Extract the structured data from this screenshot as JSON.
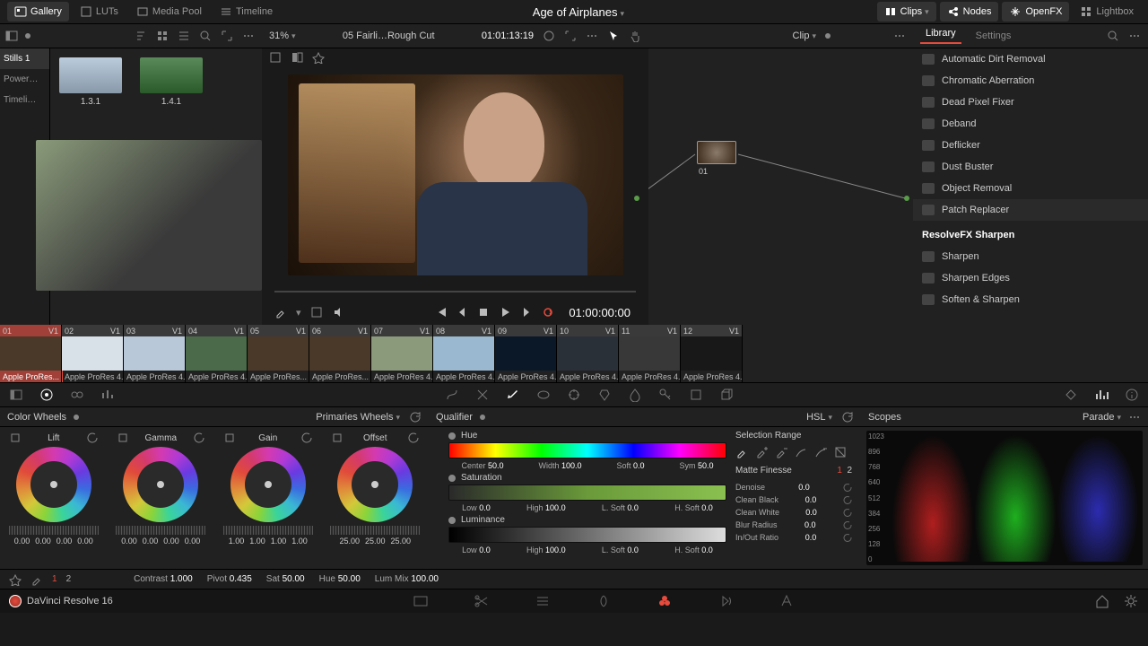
{
  "topbar": {
    "gallery": "Gallery",
    "luts": "LUTs",
    "mediapool": "Media Pool",
    "timeline": "Timeline",
    "title": "Age of Airplanes",
    "clips": "Clips",
    "nodes": "Nodes",
    "openfx": "OpenFX",
    "lightbox": "Lightbox"
  },
  "subbar": {
    "zoom": "31%",
    "project": "05 Fairli…Rough Cut",
    "timecode": "01:01:13:19",
    "nodes_mode": "Clip",
    "fx_tab1": "Library",
    "fx_tab2": "Settings"
  },
  "sidebar": [
    "Stills 1",
    "Power…",
    "Timeli…"
  ],
  "stills": [
    {
      "label": "1.3.1"
    },
    {
      "label": "1.4.1"
    }
  ],
  "viewer": {
    "tc": "01:00:00:00"
  },
  "node": {
    "label": "01"
  },
  "fx": {
    "items": [
      "Automatic Dirt Removal",
      "Chromatic Aberration",
      "Dead Pixel Fixer",
      "Deband",
      "Deflicker",
      "Dust Buster",
      "Object Removal",
      "Patch Replacer"
    ],
    "cat": "ResolveFX Sharpen",
    "items2": [
      "Sharpen",
      "Sharpen Edges",
      "Soften & Sharpen"
    ]
  },
  "clips": [
    {
      "n": "01",
      "v": "V1",
      "f": "Apple ProRes..."
    },
    {
      "n": "02",
      "v": "V1",
      "f": "Apple ProRes 4..."
    },
    {
      "n": "03",
      "v": "V1",
      "f": "Apple ProRes 4..."
    },
    {
      "n": "04",
      "v": "V1",
      "f": "Apple ProRes 4..."
    },
    {
      "n": "05",
      "v": "V1",
      "f": "Apple ProRes..."
    },
    {
      "n": "06",
      "v": "V1",
      "f": "Apple ProRes..."
    },
    {
      "n": "07",
      "v": "V1",
      "f": "Apple ProRes 4..."
    },
    {
      "n": "08",
      "v": "V1",
      "f": "Apple ProRes 4..."
    },
    {
      "n": "09",
      "v": "V1",
      "f": "Apple ProRes 4..."
    },
    {
      "n": "10",
      "v": "V1",
      "f": "Apple ProRes 4..."
    },
    {
      "n": "11",
      "v": "V1",
      "f": "Apple ProRes 4..."
    },
    {
      "n": "12",
      "v": "V1",
      "f": "Apple ProRes 4..."
    }
  ],
  "wheels": {
    "title": "Color Wheels",
    "mode": "Primaries Wheels",
    "cols": [
      {
        "name": "Lift",
        "nums": [
          "0.00",
          "0.00",
          "0.00",
          "0.00"
        ]
      },
      {
        "name": "Gamma",
        "nums": [
          "0.00",
          "0.00",
          "0.00",
          "0.00"
        ]
      },
      {
        "name": "Gain",
        "nums": [
          "1.00",
          "1.00",
          "1.00",
          "1.00"
        ]
      },
      {
        "name": "Offset",
        "nums": [
          "25.00",
          "25.00",
          "25.00"
        ]
      }
    ]
  },
  "adjust": {
    "page1": "1",
    "page2": "2",
    "contrast_l": "Contrast",
    "contrast": "1.000",
    "pivot_l": "Pivot",
    "pivot": "0.435",
    "sat_l": "Sat",
    "sat": "50.00",
    "hue_l": "Hue",
    "hue": "50.00",
    "lum_l": "Lum Mix",
    "lum": "100.00"
  },
  "qualifier": {
    "title": "Qualifier",
    "mode": "HSL",
    "hue": {
      "label": "Hue",
      "center_l": "Center",
      "center": "50.0",
      "width_l": "Width",
      "width": "100.0",
      "soft_l": "Soft",
      "soft": "0.0",
      "sym_l": "Sym",
      "sym": "50.0"
    },
    "sat": {
      "label": "Saturation",
      "low_l": "Low",
      "low": "0.0",
      "high_l": "High",
      "high": "100.0",
      "ls_l": "L. Soft",
      "ls": "0.0",
      "hs_l": "H. Soft",
      "hs": "0.0"
    },
    "lum": {
      "label": "Luminance",
      "low_l": "Low",
      "low": "0.0",
      "high_l": "High",
      "high": "100.0",
      "ls_l": "L. Soft",
      "ls": "0.0",
      "hs_l": "H. Soft",
      "hs": "0.0"
    },
    "sr": "Selection Range",
    "mf": "Matte Finesse",
    "mf1": "1",
    "mf2": "2",
    "rows": [
      {
        "l": "Denoise",
        "v": "0.0"
      },
      {
        "l": "Clean Black",
        "v": "0.0"
      },
      {
        "l": "Clean White",
        "v": "0.0"
      },
      {
        "l": "Blur Radius",
        "v": "0.0"
      },
      {
        "l": "In/Out Ratio",
        "v": "0.0"
      }
    ]
  },
  "scopes": {
    "title": "Scopes",
    "mode": "Parade",
    "ticks": [
      "1023",
      "896",
      "768",
      "640",
      "512",
      "384",
      "256",
      "128",
      "0"
    ]
  },
  "footer": {
    "brand": "DaVinci Resolve 16"
  }
}
